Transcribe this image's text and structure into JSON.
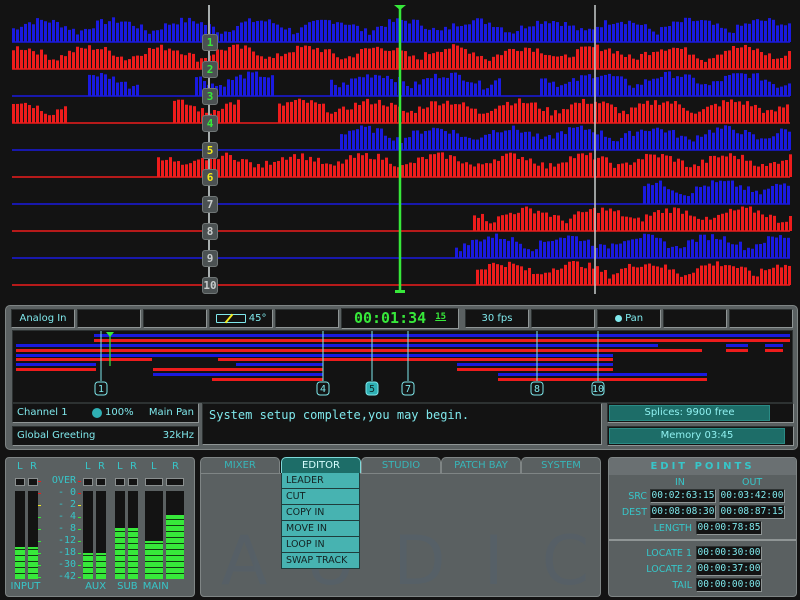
{
  "tracks": [
    {
      "id": 1,
      "label": "1",
      "color": "#1a1adf",
      "badge_color": "#37e83a",
      "level_start": 0.0
    },
    {
      "id": 2,
      "label": "2",
      "color": "#ee1c1c",
      "badge_color": "#37e83a"
    },
    {
      "id": 3,
      "label": "3",
      "color": "#1a1adf",
      "badge_color": "#37e83a"
    },
    {
      "id": 4,
      "label": "4",
      "color": "#ee1c1c",
      "badge_color": "#37e83a"
    },
    {
      "id": 5,
      "label": "5",
      "color": "#1a1adf",
      "badge_color": "#f2ea1c"
    },
    {
      "id": 6,
      "label": "6",
      "color": "#ee1c1c",
      "badge_color": "#f2ea1c"
    },
    {
      "id": 7,
      "label": "7",
      "color": "#1a1adf",
      "badge_color": "#c8cccc"
    },
    {
      "id": 8,
      "label": "8",
      "color": "#ee1c1c",
      "badge_color": "#c8cccc"
    },
    {
      "id": 9,
      "label": "9",
      "color": "#1a1adf",
      "badge_color": "#c8cccc"
    },
    {
      "id": 10,
      "label": "10",
      "color": "#ee1c1c",
      "badge_color": "#c8cccc"
    }
  ],
  "toolbar": {
    "input_source": "Analog In",
    "angle": "45°",
    "timecode": "00:01:34",
    "timecode_frames": "15",
    "frame_rate": "30 fps",
    "pan_label": "Pan"
  },
  "overview": {
    "markers": [
      "1",
      "4",
      "5",
      "7",
      "8",
      "10"
    ],
    "active_marker": "5"
  },
  "channel": {
    "name": "Channel 1",
    "level": "100%",
    "pan": "Main Pan",
    "project": "Global Greeting",
    "sample_rate": "32kHz"
  },
  "message": "System setup complete,you may begin.",
  "status": {
    "splices": "Splices: 9900 free",
    "splices_fill": 0.88,
    "memory": "Memory 03:45",
    "memory_fill": 0.96
  },
  "meters": {
    "channel_lr": [
      "L",
      "R"
    ],
    "scale": [
      "OVER",
      "- 0",
      "- 2",
      "- 4",
      "- 8",
      "-12",
      "-18",
      "-30",
      "-42"
    ],
    "groups": [
      {
        "name": "INPUT",
        "levels": [
          0.36,
          0.36
        ]
      },
      {
        "name": "AUX",
        "levels": [
          0.3,
          0.3
        ]
      },
      {
        "name": "SUB",
        "levels": [
          0.58,
          0.58
        ]
      },
      {
        "name": "MAIN",
        "levels": [
          0.43,
          0.73
        ]
      }
    ]
  },
  "tabs": {
    "items": [
      "MIXER",
      "EDITOR",
      "STUDIO",
      "PATCH BAY",
      "SYSTEM"
    ],
    "active": "EDITOR",
    "watermark": "AUDICY",
    "editor_menu": [
      "LEADER",
      "CUT",
      "COPY IN",
      "MOVE IN",
      "LOOP IN",
      "SWAP TRACK"
    ]
  },
  "edit_points": {
    "title": "EDIT POINTS",
    "in_label": "IN",
    "out_label": "OUT",
    "src_label": "SRC",
    "src_in": "00:02:63:15",
    "src_out": "00:03:42:00",
    "dest_label": "DEST",
    "dest_in": "00:08:08:30",
    "dest_out": "00:08:87:15",
    "length_label": "LENGTH",
    "length": "00:00:78:85",
    "locate1_label": "LOCATE 1",
    "locate1": "00:00:30:00",
    "locate2_label": "LOCATE 2",
    "locate2": "00:00:37:00",
    "tail_label": "TAIL",
    "tail": "00:00:00:00"
  }
}
